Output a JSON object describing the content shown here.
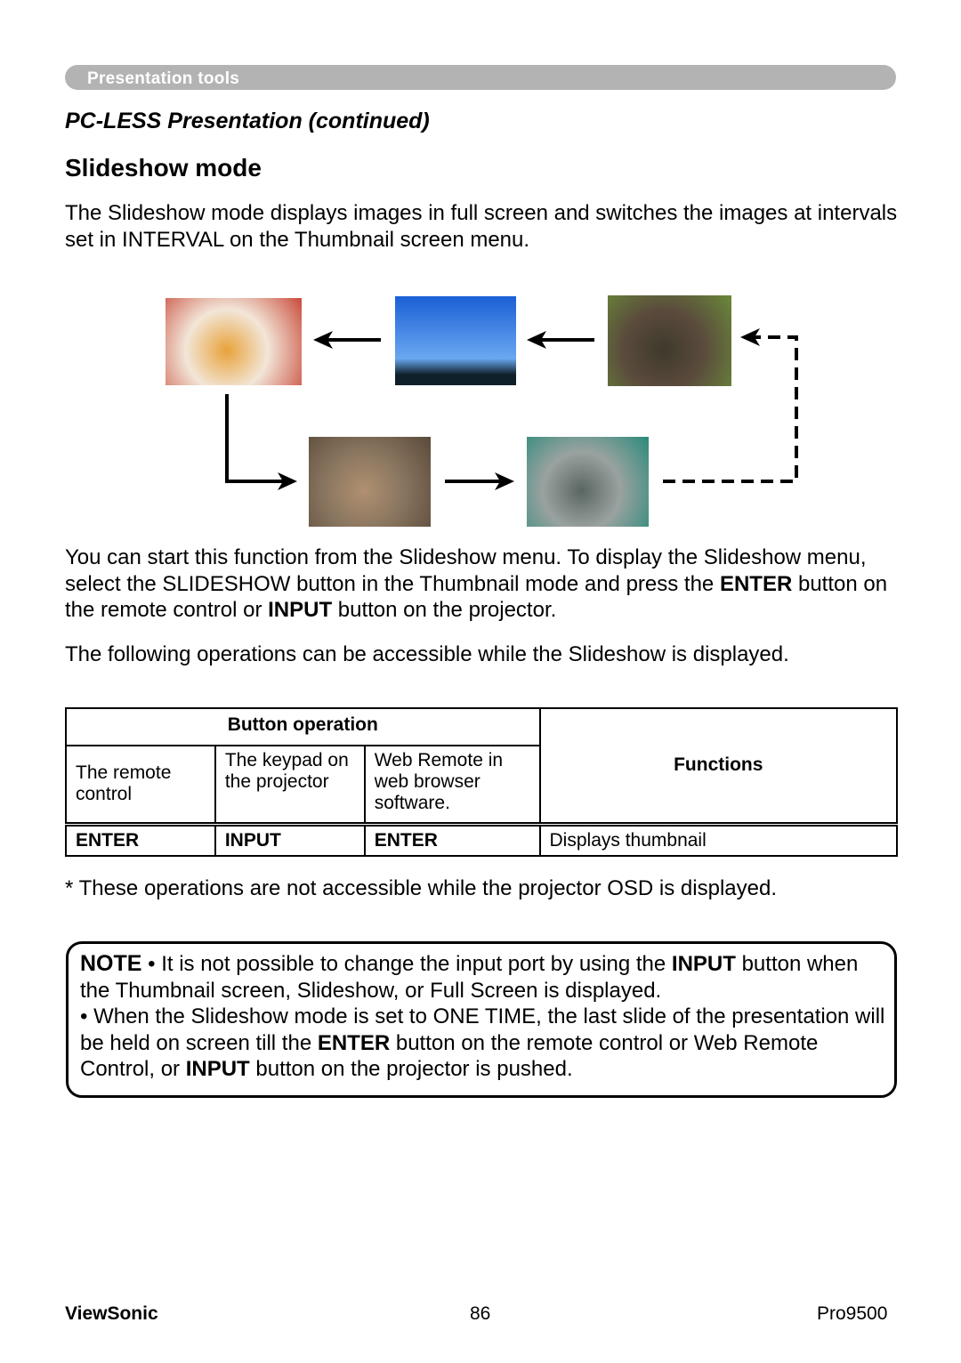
{
  "header": {
    "section": "Presentation tools"
  },
  "subtitle": "PC-LESS Presentation (continued)",
  "title": "Slideshow mode",
  "intro": "The Slideshow mode displays images in full screen and switches the images at intervals set in INTERVAL on the Thumbnail screen menu.",
  "diagram": {
    "images": [
      {
        "name": "food-photo",
        "colors": [
          "#f2e6d8",
          "#e8a23a",
          "#c94a3a"
        ]
      },
      {
        "name": "sky-mountain-photo",
        "colors": [
          "#1a5fd6",
          "#6aa8f0",
          "#10202a"
        ]
      },
      {
        "name": "red-panda-photo",
        "colors": [
          "#5a4a3c",
          "#3e3a2c",
          "#6a8a3a"
        ]
      },
      {
        "name": "lion-photo",
        "colors": [
          "#8a7660",
          "#b09070",
          "#5a4a3a"
        ]
      },
      {
        "name": "penguins-photo",
        "colors": [
          "#9aa2a0",
          "#5a6662",
          "#2a8a7a"
        ]
      }
    ]
  },
  "para2": {
    "part1": "You can start this function from the Slideshow menu. To display the Slideshow menu, select the SLIDESHOW button in the Thumbnail mode and press the ",
    "bold1": "ENTER",
    "part2": " button on the remote control or ",
    "bold2": "INPUT",
    "part3": " button on the projector."
  },
  "para3": "The following operations can be accessible while the Slideshow is displayed.",
  "table": {
    "group_header": "Button operation",
    "functions_header": "Functions",
    "col_headers": [
      "The remote control",
      "The keypad on the projector",
      "Web Remote in web browser software."
    ],
    "rows": [
      {
        "remote": "ENTER",
        "keypad": "INPUT",
        "web": "ENTER",
        "function": "Displays thumbnail"
      }
    ]
  },
  "footnote": "* These operations are not accessible while the projector OSD is displayed.",
  "note": {
    "label": "NOTE",
    "b1_part1": " • It is not possible to change the input port by using the ",
    "b1_bold": "INPUT",
    "b1_part2": " button when the Thumbnail screen, Slideshow, or Full Screen is displayed.",
    "b2_part1": "• When the Slideshow mode is set to ONE TIME, the last slide of the presentation will be held on screen till the ",
    "b2_bold1": "ENTER",
    "b2_part2": " button on the remote control or Web Remote Control, or ",
    "b2_bold2": "INPUT",
    "b2_part3": " button on the projector is pushed."
  },
  "footer": {
    "brand": "ViewSonic",
    "page": "86",
    "model": "Pro9500"
  }
}
